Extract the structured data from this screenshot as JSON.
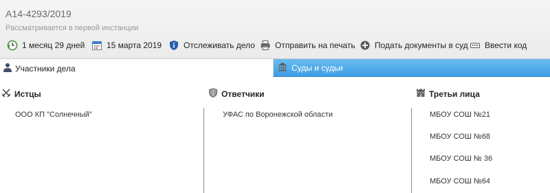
{
  "case": {
    "number": "А14-4293/2019",
    "status": "Рассматривается в первой инстанции"
  },
  "toolbar": {
    "duration": "1 месяц 29 дней",
    "date": "15 марта 2019",
    "track": "Отслеживать дело",
    "print": "Отправить на печать",
    "submit": "Подать документы в суд",
    "code": "Ввести код"
  },
  "tabs": {
    "participants": "Участники дела",
    "courts": "Суды и судьи"
  },
  "columns": {
    "plaintiffs": {
      "title": "Истцы",
      "items": [
        "ООО КП \"Солнечный\""
      ]
    },
    "defendants": {
      "title": "Ответчики",
      "items": [
        "УФАС по Воронежской области"
      ]
    },
    "third_parties": {
      "title": "Третьи лица",
      "items": [
        "МБОУ СОШ №21",
        "МБОУ СОШ №68",
        "МБОУ СОШ № 36",
        "МБОУ СОШ №64"
      ]
    }
  },
  "colors": {
    "accent": "#3d9ee3",
    "info_icon": "#2a5fb0",
    "calendar_icon": "#3a7bd5"
  }
}
